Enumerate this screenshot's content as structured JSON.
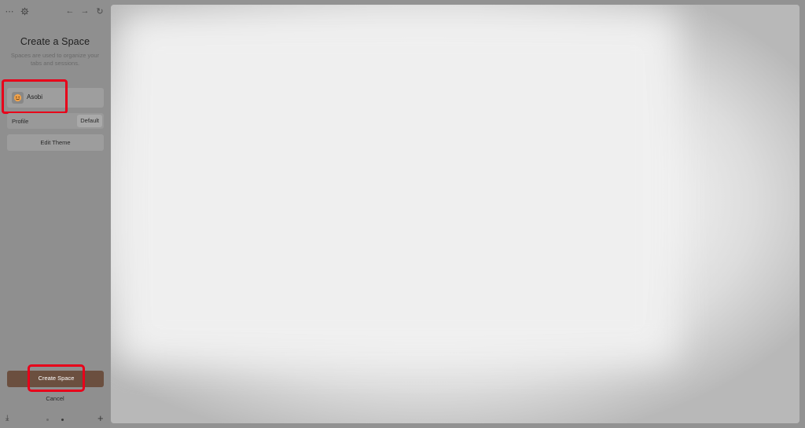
{
  "topbar": {
    "menu_icon": "⋯",
    "settings_icon": "⚙",
    "back_icon": "←",
    "forward_icon": "→",
    "reload_icon": "↻"
  },
  "sidebar": {
    "title": "Create a Space",
    "subtitle": "Spaces are used to organize your tabs and sessions.",
    "space_name": "Asobi",
    "profile_label": "Profile",
    "profile_value": "Default",
    "edit_theme_label": "Edit Theme",
    "create_label": "Create Space",
    "cancel_label": "Cancel",
    "download_icon": "⤓",
    "add_icon": "+"
  },
  "colors": {
    "highlight": "#e8001a",
    "create_button": "#6b4f3f"
  }
}
